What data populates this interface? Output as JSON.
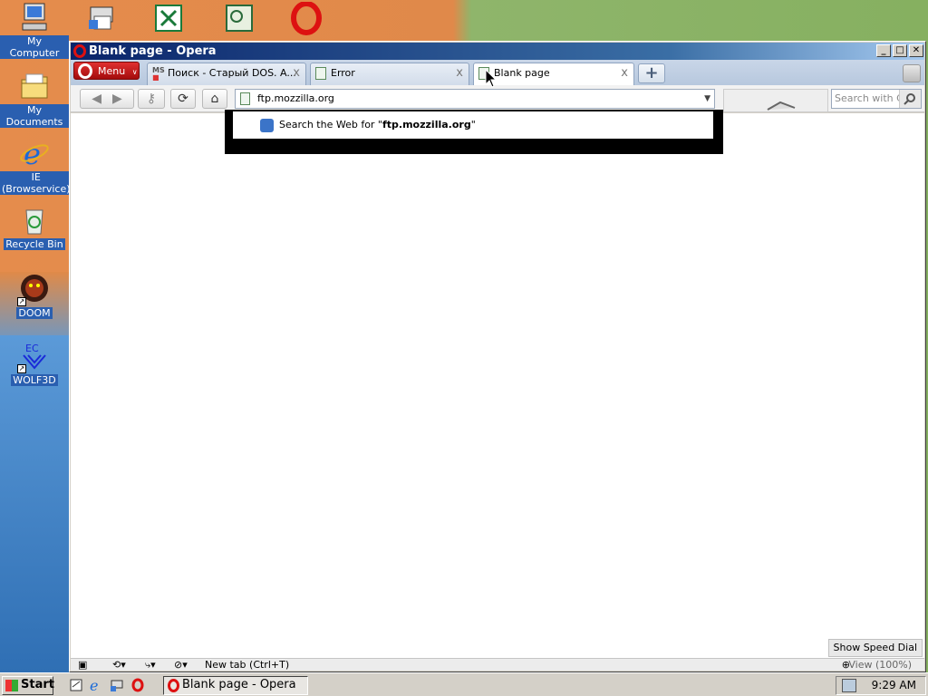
{
  "desktop": {
    "icons": [
      {
        "label": "My Computer"
      },
      {
        "label": "My Documents"
      },
      {
        "label": "IE\n(Browservice)"
      },
      {
        "label": "Recycle Bin"
      },
      {
        "label": "DOOM"
      },
      {
        "label": "WOLF3D"
      }
    ],
    "top_icons": [
      "network-printer-icon",
      "excel-icon",
      "project-icon",
      "opera-icon"
    ]
  },
  "window": {
    "title": "Blank page - Opera",
    "controls": {
      "minimize": "_",
      "maximize": "□",
      "close": "✕"
    }
  },
  "tabs": {
    "menu_label": "Menu",
    "items": [
      {
        "label": "Поиск - Старый DOS. A...",
        "close": "x"
      },
      {
        "label": "Error",
        "close": "x"
      },
      {
        "label": "Blank page",
        "close": "x"
      }
    ],
    "new_tab": "+"
  },
  "toolbar": {
    "address": "ftp.mozzilla.org",
    "search_placeholder": "Search with Co"
  },
  "dropdown": {
    "prefix": "Search the Web for \"",
    "query": "ftp.mozzilla.org",
    "suffix": "\""
  },
  "page": {
    "speed_dial_button": "Show Speed Dial"
  },
  "statusbar": {
    "new_tab_hint": "New tab (Ctrl+T)",
    "view_label": "View (100%)"
  },
  "taskbar": {
    "start": "Start",
    "task": "Blank page - Opera",
    "clock": "9:29 AM"
  },
  "colors": {
    "opera_red": "#cc1111",
    "title_blue": "#0a246a",
    "icon_label_bg": "#2a5fb0"
  }
}
